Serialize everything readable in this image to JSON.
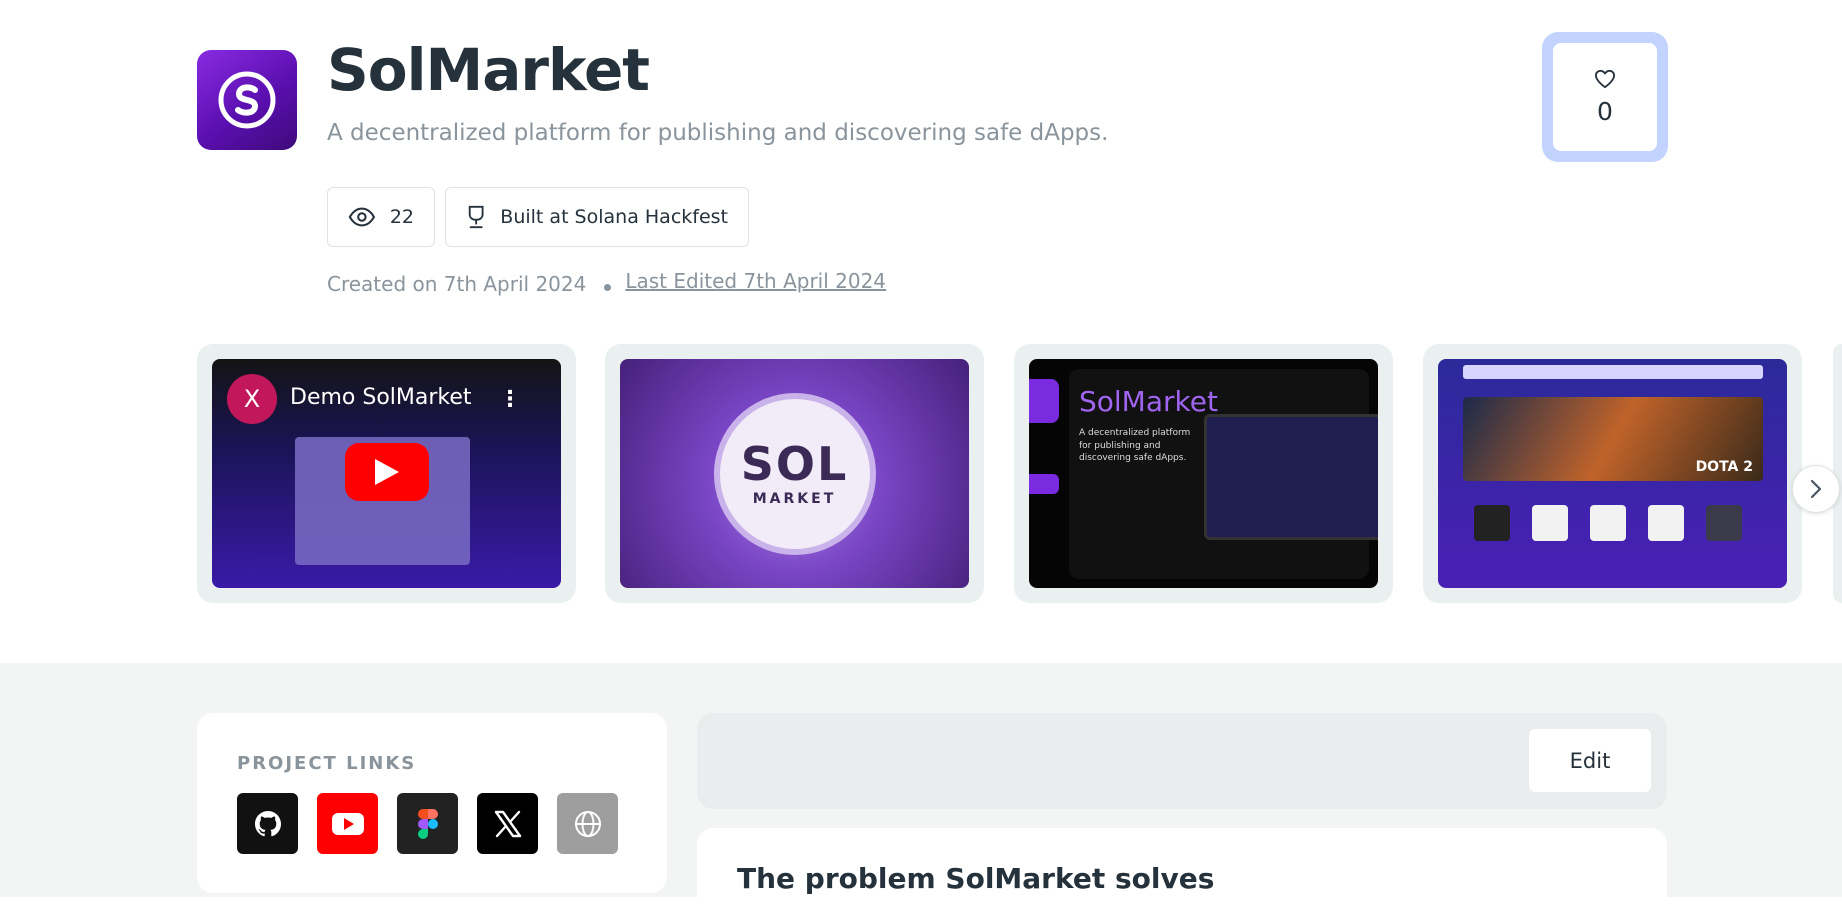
{
  "project": {
    "name": "SolMarket",
    "tagline": "A decentralized platform for publishing and discovering safe dApps.",
    "views": "22",
    "hackathon": "Built at Solana Hackfest",
    "created": "Created on 7th April 2024",
    "edited": "Last Edited 7th April 2024",
    "likes": "0"
  },
  "gallery": {
    "video": {
      "avatar_letter": "X",
      "title": "Demo SolMarket"
    },
    "logo_card": {
      "word": "SOL",
      "sub": "MARKET"
    },
    "promo": {
      "brand": "SolMarket",
      "desc": "A decentralized platform for publishing and discovering safe dApps."
    },
    "screenshot": {
      "hero_label": "DOTA 2"
    }
  },
  "links": {
    "title": "PROJECT LINKS",
    "items": [
      {
        "name": "github-icon",
        "color": "#111111"
      },
      {
        "name": "youtube-icon",
        "color": "#ff0000"
      },
      {
        "name": "figma-icon",
        "color": "#222222"
      },
      {
        "name": "x-icon",
        "color": "#000000"
      },
      {
        "name": "globe-icon",
        "color": "#9e9e9e"
      }
    ]
  },
  "editor": {
    "edit_label": "Edit"
  },
  "sections": {
    "problem_title": "The problem SolMarket solves"
  },
  "colors": {
    "brand_purple": "#7a2be0",
    "like_border": "#c2d3ff",
    "page_bg_lower": "#f3f5f5"
  }
}
